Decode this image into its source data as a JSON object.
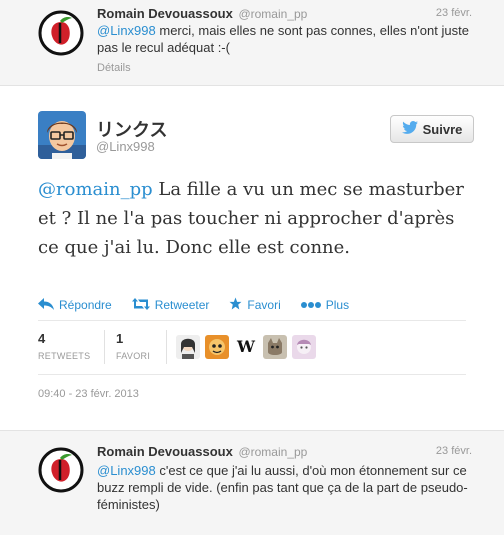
{
  "reply_top": {
    "name": "Romain Devouassoux",
    "handle": "@romain_pp",
    "date": "23 févr.",
    "mention": "@Linx998",
    "text": " merci, mais elles ne sont pas connes, elles n'ont juste pas le recul adéquat :-(",
    "details": "Détails"
  },
  "main_tweet": {
    "name": "リンクス",
    "handle": "@Linx998",
    "follow_label": "Suivre",
    "mention": "@romain_pp",
    "text": " La fille a vu un mec se masturber et ? Il ne l'a pas toucher ni approcher d'après ce que j'ai lu. Donc elle est conne.",
    "actions": {
      "reply": "Répondre",
      "retweet": "Retweeter",
      "favorite": "Favori",
      "more": "Plus"
    },
    "stats": {
      "retweets_count": "4",
      "retweets_label": "RETWEETS",
      "favorites_count": "1",
      "favorites_label": "FAVORI"
    },
    "timestamp": "09:40 - 23 févr. 2013"
  },
  "reply_bottom": {
    "name": "Romain Devouassoux",
    "handle": "@romain_pp",
    "date": "23 févr.",
    "mention": "@Linx998",
    "text": " c'est ce que j'ai lu aussi, d'où mon étonnement sur ce buzz rempli de vide. (enfin pas tant que ça de la part de pseudo-féministes)"
  },
  "colors": {
    "link": "#2a8ed0",
    "muted": "#999999",
    "twitter_blue": "#55acee",
    "pirate_red": "#d0202a",
    "pirate_green": "#3a9a2e"
  },
  "icons": {
    "pirate_logo": "pirate-party-icon",
    "twitter_bird": "twitter-bird-icon",
    "reply": "reply-arrow-icon",
    "retweet": "retweet-icon",
    "favorite": "star-icon",
    "more": "ellipsis-icon"
  }
}
